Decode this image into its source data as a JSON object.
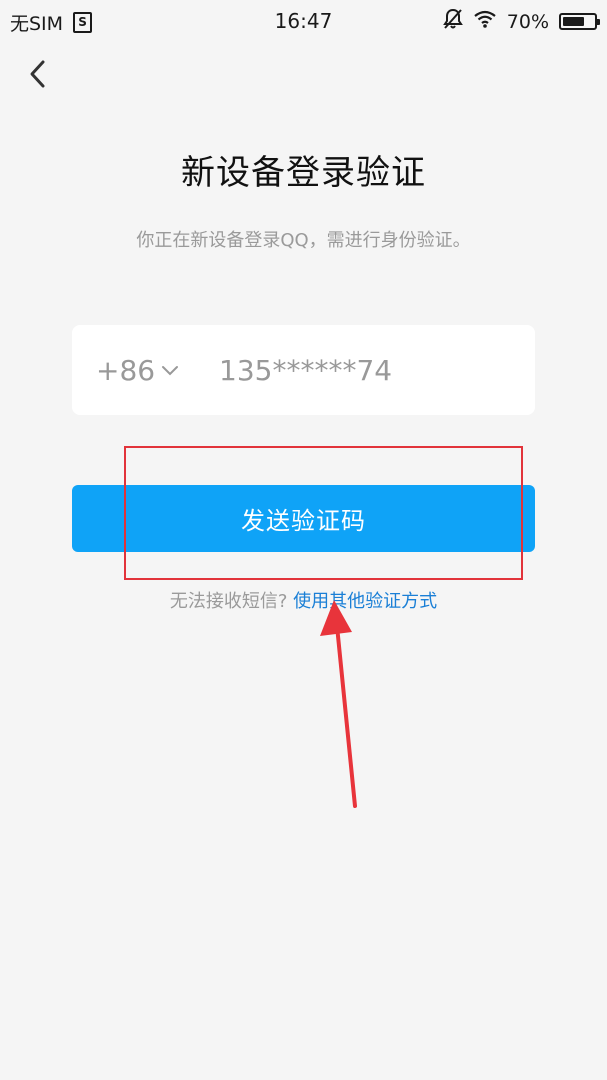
{
  "status_bar": {
    "carrier": "无SIM",
    "sim_icon_text": "S",
    "time": "16:47",
    "battery_percent": "70%",
    "battery_level": 0.7
  },
  "icons": {
    "back": "chevron-left-icon",
    "mute": "bell-off-icon",
    "wifi": "wifi-icon",
    "dropdown": "chevron-down-icon"
  },
  "page": {
    "title": "新设备登录验证",
    "subtitle": "你正在新设备登录QQ，需进行身份验证。"
  },
  "phone": {
    "country_code": "+86",
    "number": "135******74"
  },
  "actions": {
    "send_code_label": "发送验证码",
    "cannot_receive_text": "无法接收短信?",
    "other_method_link": "使用其他验证方式"
  },
  "colors": {
    "primary": "#0fa3f7",
    "link": "#1a7fd6",
    "annotation": "#e2333a",
    "background": "#f5f5f5"
  }
}
